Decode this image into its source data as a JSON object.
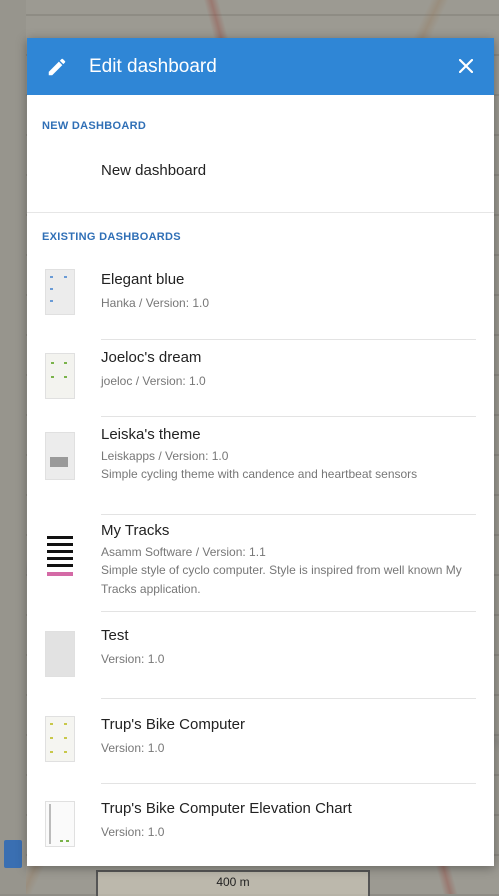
{
  "map": {
    "scale_label": "400 m"
  },
  "dialog": {
    "title": "Edit dashboard",
    "close_icon": "close-icon",
    "edit_icon": "pencil-icon"
  },
  "new_section": {
    "heading": "NEW DASHBOARD",
    "item_label": "New dashboard"
  },
  "existing_section": {
    "heading": "EXISTING DASHBOARDS",
    "items": [
      {
        "name": "Elegant blue",
        "meta": "Hanka / Version: 1.0",
        "desc": ""
      },
      {
        "name": "Joeloc's dream",
        "meta": "joeloc / Version: 1.0",
        "desc": ""
      },
      {
        "name": "Leiska's theme",
        "meta": "Leiskapps / Version: 1.0",
        "desc": "Simple cycling theme with candence and heartbeat sensors"
      },
      {
        "name": "My Tracks",
        "meta": "Asamm Software / Version: 1.1",
        "desc": "Simple style of cyclo computer. Style is inspired from well known My Tracks application."
      },
      {
        "name": "Test",
        "meta": "Version: 1.0",
        "desc": ""
      },
      {
        "name": "Trup's Bike Computer",
        "meta": "Version: 1.0",
        "desc": ""
      },
      {
        "name": "Trup's Bike Computer Elevation Chart",
        "meta": "Version: 1.0",
        "desc": ""
      }
    ]
  },
  "colors": {
    "header": "#2f86d6",
    "section_heading": "#2f6fb6"
  }
}
